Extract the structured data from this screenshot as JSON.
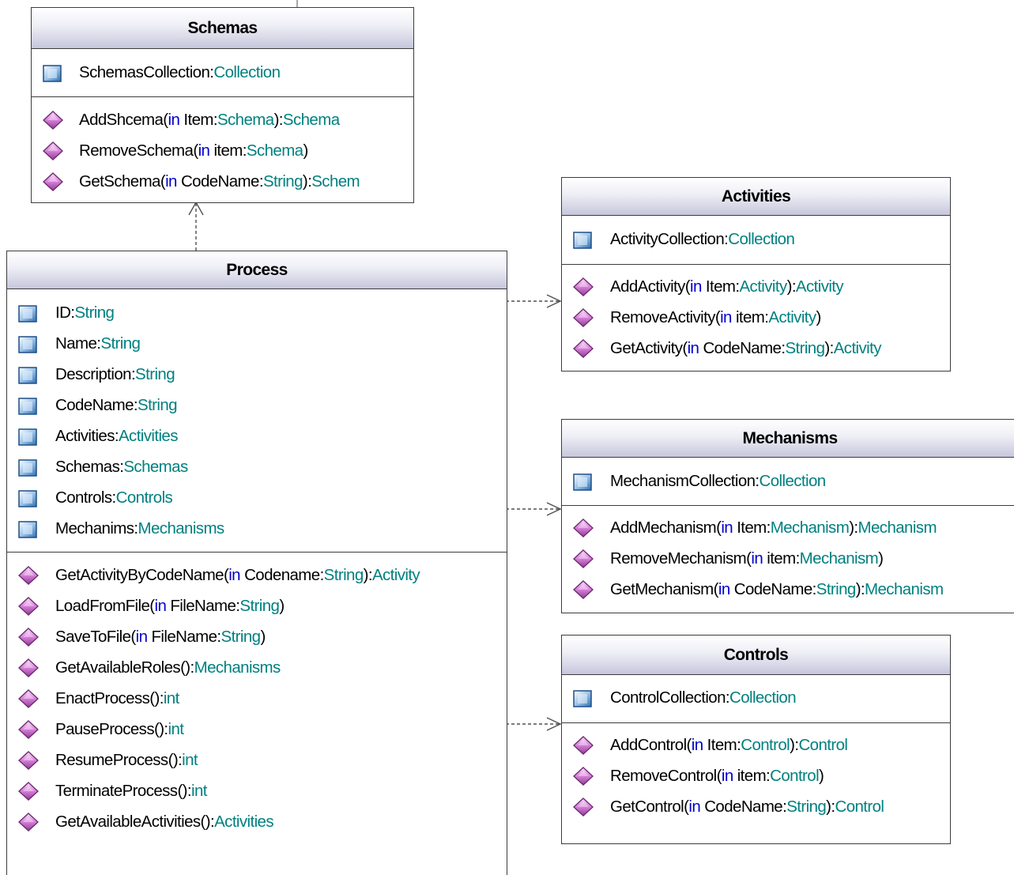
{
  "classes": [
    {
      "key": "schemas",
      "title": "Schemas",
      "attributes": [
        [
          {
            "t": "SchemasCollection:"
          },
          {
            "t": "Collection",
            "k": "ty"
          }
        ]
      ],
      "methods": [
        [
          {
            "t": "AddShcema("
          },
          {
            "t": "in",
            "k": "kw"
          },
          {
            "t": " Item:"
          },
          {
            "t": "Schema",
            "k": "ty"
          },
          {
            "t": "):"
          },
          {
            "t": "Schema",
            "k": "ty"
          }
        ],
        [
          {
            "t": "RemoveSchema("
          },
          {
            "t": "in",
            "k": "kw"
          },
          {
            "t": " item:"
          },
          {
            "t": "Schema",
            "k": "ty"
          },
          {
            "t": ")"
          }
        ],
        [
          {
            "t": "GetSchema("
          },
          {
            "t": "in",
            "k": "kw"
          },
          {
            "t": " CodeName:"
          },
          {
            "t": "String",
            "k": "ty"
          },
          {
            "t": "):"
          },
          {
            "t": "Schem",
            "k": "ty"
          }
        ]
      ]
    },
    {
      "key": "process",
      "title": "Process",
      "attributes": [
        [
          {
            "t": "ID:"
          },
          {
            "t": "String",
            "k": "ty"
          }
        ],
        [
          {
            "t": "Name:"
          },
          {
            "t": "String",
            "k": "ty"
          }
        ],
        [
          {
            "t": "Description:"
          },
          {
            "t": "String",
            "k": "ty"
          }
        ],
        [
          {
            "t": "CodeName:"
          },
          {
            "t": "String",
            "k": "ty"
          }
        ],
        [
          {
            "t": "Activities:"
          },
          {
            "t": "Activities",
            "k": "ty"
          }
        ],
        [
          {
            "t": "Schemas:"
          },
          {
            "t": "Schemas",
            "k": "ty"
          }
        ],
        [
          {
            "t": "Controls:"
          },
          {
            "t": "Controls",
            "k": "ty"
          }
        ],
        [
          {
            "t": "Mechanims:"
          },
          {
            "t": "Mechanisms",
            "k": "ty"
          }
        ]
      ],
      "methods": [
        [
          {
            "t": "GetActivityByCodeName("
          },
          {
            "t": "in",
            "k": "kw"
          },
          {
            "t": " Codename:"
          },
          {
            "t": "String",
            "k": "ty"
          },
          {
            "t": "):"
          },
          {
            "t": "Activity",
            "k": "ty"
          }
        ],
        [
          {
            "t": "LoadFromFile("
          },
          {
            "t": "in",
            "k": "kw"
          },
          {
            "t": " FileName:"
          },
          {
            "t": "String",
            "k": "ty"
          },
          {
            "t": ")"
          }
        ],
        [
          {
            "t": "SaveToFile("
          },
          {
            "t": "in",
            "k": "kw"
          },
          {
            "t": " FileName:"
          },
          {
            "t": "String",
            "k": "ty"
          },
          {
            "t": ")"
          }
        ],
        [
          {
            "t": "GetAvailableRoles():"
          },
          {
            "t": "Mechanisms",
            "k": "ty"
          }
        ],
        [
          {
            "t": "EnactProcess():"
          },
          {
            "t": "int",
            "k": "ty"
          }
        ],
        [
          {
            "t": "PauseProcess():"
          },
          {
            "t": "int",
            "k": "ty"
          }
        ],
        [
          {
            "t": "ResumeProcess():"
          },
          {
            "t": "int",
            "k": "ty"
          }
        ],
        [
          {
            "t": "TerminateProcess():"
          },
          {
            "t": "int",
            "k": "ty"
          }
        ],
        [
          {
            "t": "GetAvailableActivities():"
          },
          {
            "t": "Activities",
            "k": "ty"
          }
        ]
      ]
    },
    {
      "key": "activities",
      "title": "Activities",
      "attributes": [
        [
          {
            "t": "ActivityCollection:"
          },
          {
            "t": "Collection",
            "k": "ty"
          }
        ]
      ],
      "methods": [
        [
          {
            "t": "AddActivity("
          },
          {
            "t": "in",
            "k": "kw"
          },
          {
            "t": " Item:"
          },
          {
            "t": "Activity",
            "k": "ty"
          },
          {
            "t": "):"
          },
          {
            "t": "Activity",
            "k": "ty"
          }
        ],
        [
          {
            "t": "RemoveActivity("
          },
          {
            "t": "in",
            "k": "kw"
          },
          {
            "t": " item:"
          },
          {
            "t": "Activity",
            "k": "ty"
          },
          {
            "t": ")"
          }
        ],
        [
          {
            "t": "GetActivity("
          },
          {
            "t": "in",
            "k": "kw"
          },
          {
            "t": " CodeName:"
          },
          {
            "t": "String",
            "k": "ty"
          },
          {
            "t": "):"
          },
          {
            "t": "Activity",
            "k": "ty"
          }
        ]
      ]
    },
    {
      "key": "mechanisms",
      "title": "Mechanisms",
      "attributes": [
        [
          {
            "t": "MechanismCollection:"
          },
          {
            "t": "Collection",
            "k": "ty"
          }
        ]
      ],
      "methods": [
        [
          {
            "t": "AddMechanism("
          },
          {
            "t": "in",
            "k": "kw"
          },
          {
            "t": " Item:"
          },
          {
            "t": "Mechanism",
            "k": "ty"
          },
          {
            "t": "):"
          },
          {
            "t": "Mechanism",
            "k": "ty"
          }
        ],
        [
          {
            "t": "RemoveMechanism("
          },
          {
            "t": "in",
            "k": "kw"
          },
          {
            "t": " item:"
          },
          {
            "t": "Mechanism",
            "k": "ty"
          },
          {
            "t": ")"
          }
        ],
        [
          {
            "t": "GetMechanism("
          },
          {
            "t": "in",
            "k": "kw"
          },
          {
            "t": " CodeName:"
          },
          {
            "t": "String",
            "k": "ty"
          },
          {
            "t": "):"
          },
          {
            "t": "Mechanism",
            "k": "ty"
          }
        ]
      ]
    },
    {
      "key": "controls",
      "title": "Controls",
      "attributes": [
        [
          {
            "t": "ControlCollection:"
          },
          {
            "t": "Collection",
            "k": "ty"
          }
        ]
      ],
      "methods": [
        [
          {
            "t": "AddControl("
          },
          {
            "t": "in",
            "k": "kw"
          },
          {
            "t": " Item:"
          },
          {
            "t": "Control",
            "k": "ty"
          },
          {
            "t": "):"
          },
          {
            "t": "Control",
            "k": "ty"
          }
        ],
        [
          {
            "t": "RemoveControl("
          },
          {
            "t": "in",
            "k": "kw"
          },
          {
            "t": " item:"
          },
          {
            "t": "Control",
            "k": "ty"
          },
          {
            "t": ")"
          }
        ],
        [
          {
            "t": "GetControl("
          },
          {
            "t": "in",
            "k": "kw"
          },
          {
            "t": " CodeName:"
          },
          {
            "t": "String",
            "k": "ty"
          },
          {
            "t": "):"
          },
          {
            "t": "Control",
            "k": "ty"
          }
        ]
      ]
    }
  ],
  "colors": {
    "keyword": "#0000cc",
    "type": "#008080",
    "header_gradient_bottom": "#c6c6dc",
    "attribute_icon": "#5b9bd5",
    "method_icon": "#d77fd9"
  },
  "icons": {
    "attribute": "field-icon",
    "method": "method-icon"
  },
  "relations": [
    {
      "from": "Process",
      "to": "Schemas",
      "style": "dashed-open-arrow"
    },
    {
      "from": "Process",
      "to": "Activities",
      "style": "dashed-open-arrow"
    },
    {
      "from": "Process",
      "to": "Mechanisms",
      "style": "dashed-open-arrow"
    },
    {
      "from": "Process",
      "to": "Controls",
      "style": "dashed-open-arrow"
    }
  ]
}
